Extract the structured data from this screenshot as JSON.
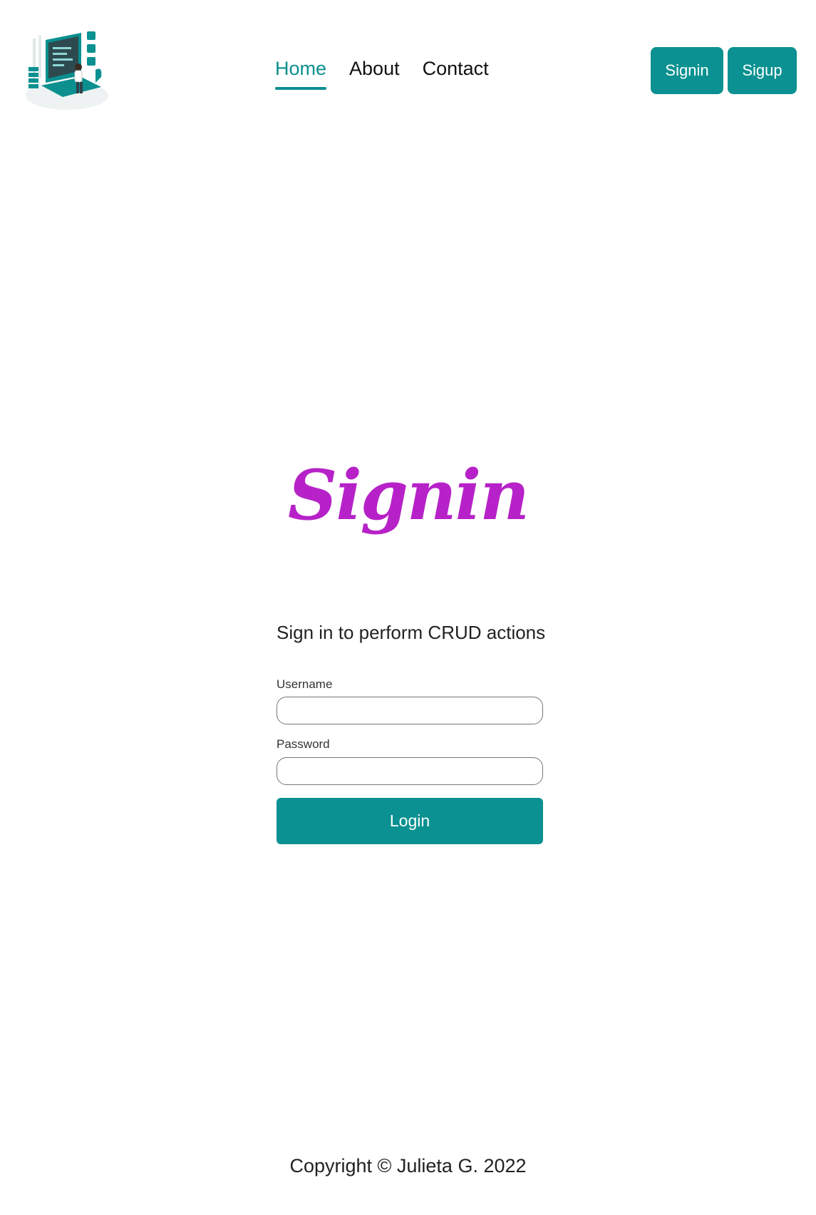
{
  "header": {
    "logo_icon": "developer-laptop-illustration",
    "nav": [
      {
        "label": "Home",
        "active": true
      },
      {
        "label": "About",
        "active": false
      },
      {
        "label": "Contact",
        "active": false
      }
    ],
    "signin_button": "Signin",
    "signup_button": "Sigup"
  },
  "main": {
    "title": "Signin",
    "subtitle": "Sign in to perform CRUD actions",
    "username_label": "Username",
    "username_value": "",
    "password_label": "Password",
    "password_value": "",
    "login_button": "Login"
  },
  "footer": {
    "copyright": "Copyright © Julieta G. 2022"
  },
  "colors": {
    "accent": "#0b9191",
    "title": "#b622c8"
  }
}
